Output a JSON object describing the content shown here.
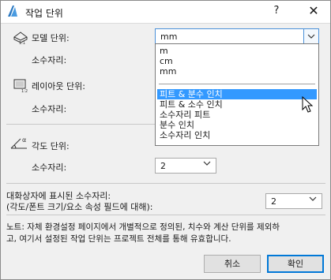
{
  "window": {
    "title": "작업 단위",
    "help": "?",
    "close": "✕"
  },
  "model": {
    "label": "모델 단위:",
    "decimals_label": "소수자리:",
    "selected": "mm",
    "options_group1": [
      "m",
      "cm",
      "mm"
    ],
    "options_group2": [
      "피트 &  분수 인치",
      "피트 & 소수 인치",
      "소수자리 피트",
      "분수 인치",
      "소수자리 인치"
    ],
    "highlighted_index": 0
  },
  "layout": {
    "label": "레이아웃 단위:",
    "decimals_label": "소수자리:"
  },
  "angle": {
    "label": "각도 단위:",
    "decimals_label": "소수자리:",
    "decimals_value": "2"
  },
  "dialog_decimals": {
    "label_line1": "대화상자에 표시된 소수자리:",
    "label_line2": "(각도/폰트 크기/요소 속성 필드에 대해):",
    "value": "2"
  },
  "note": {
    "line1": "노트: 자체 환경설정 페이지에서 개별적으로 정의된, 치수와 계산 단위를 제외하",
    "line2": "고, 여기서 설정된 작업 단위는 프로젝트 전체를 통해 유효합니다."
  },
  "buttons": {
    "cancel": "취소",
    "ok": "확인"
  },
  "colors": {
    "highlight": "#3399ff",
    "focus_border": "#4a90d9"
  }
}
